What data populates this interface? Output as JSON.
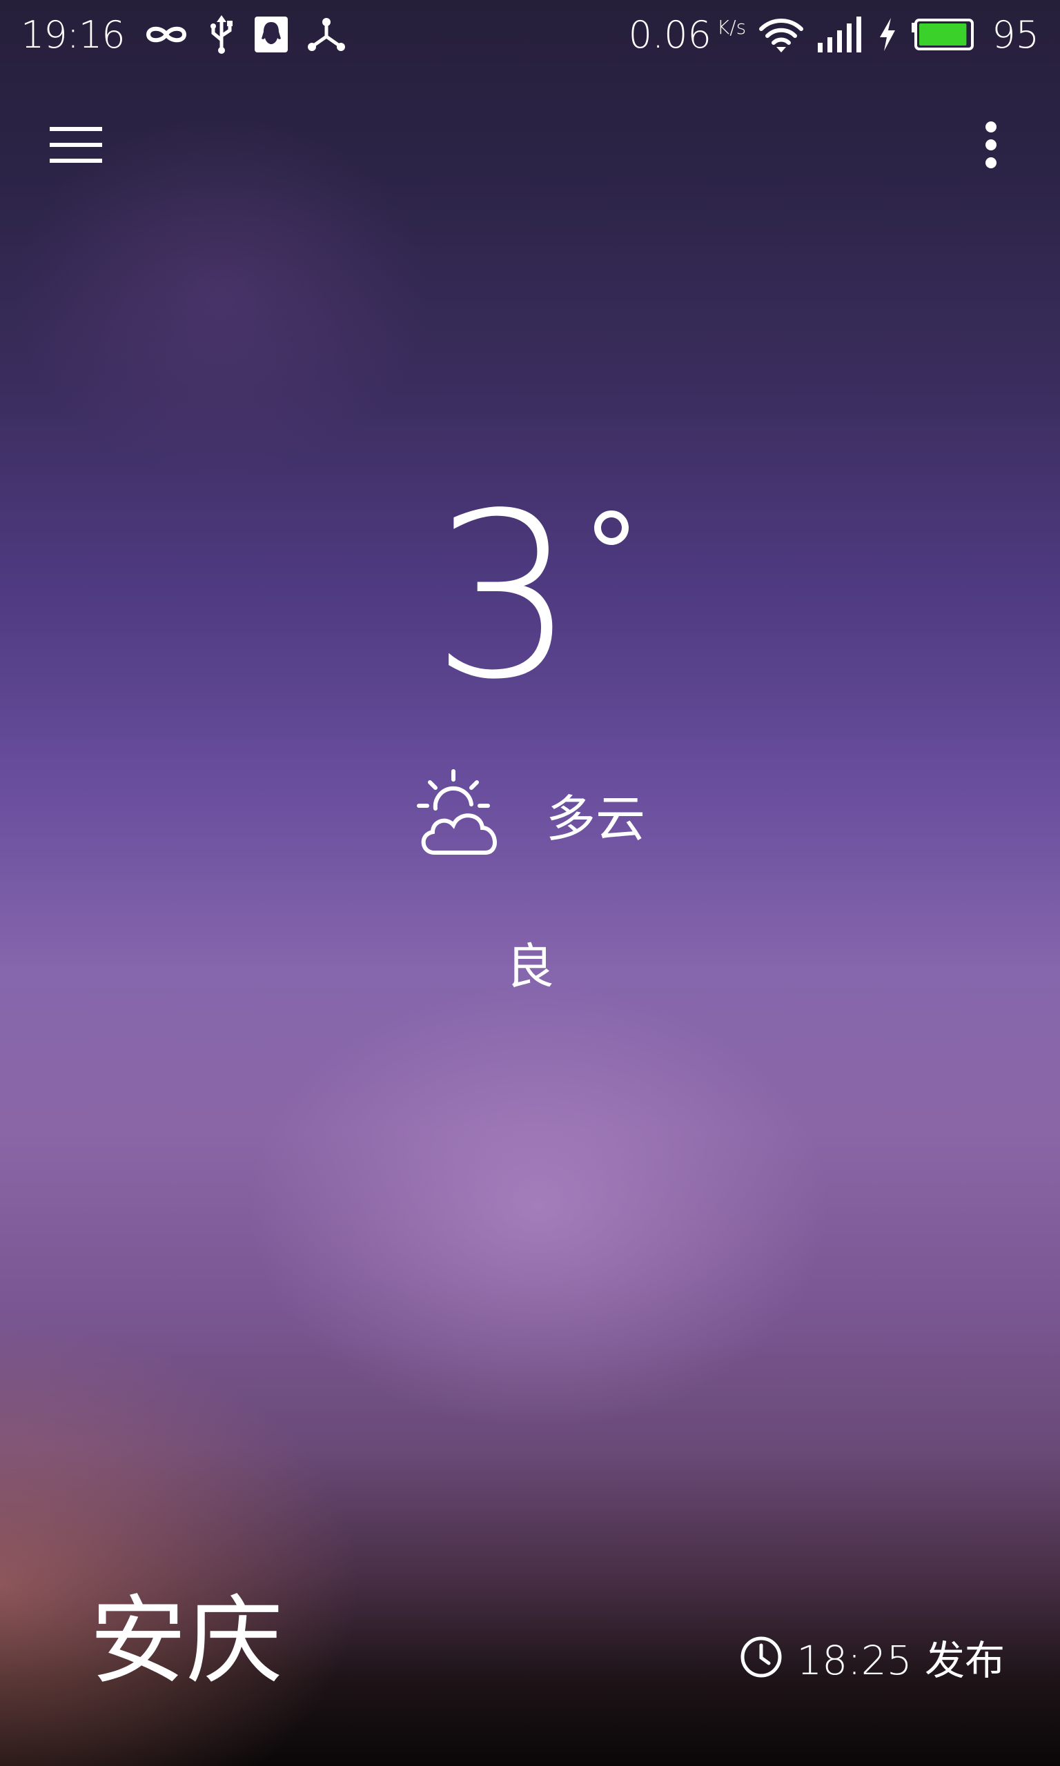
{
  "status_bar": {
    "time": "19:16",
    "left_icons": [
      "infinity-icon",
      "usb-icon",
      "qq-notification-icon",
      "share-nodes-icon"
    ],
    "net_speed": "0.06",
    "net_speed_unit": "K/s",
    "right_icons": [
      "wifi-icon",
      "signal-icon",
      "charging-icon",
      "battery-icon"
    ],
    "battery_level": "95",
    "battery_color": "#3ad12a"
  },
  "toolbar": {
    "menu_icon": "hamburger-menu-icon",
    "overflow_icon": "more-vertical-icon"
  },
  "weather": {
    "temperature": "3",
    "degree_symbol": "°",
    "condition_icon": "partly-cloudy-icon",
    "condition": "多云",
    "air_quality": "良"
  },
  "footer": {
    "city": "安庆",
    "clock_icon": "clock-icon",
    "publish_time": "18:25 发布"
  }
}
